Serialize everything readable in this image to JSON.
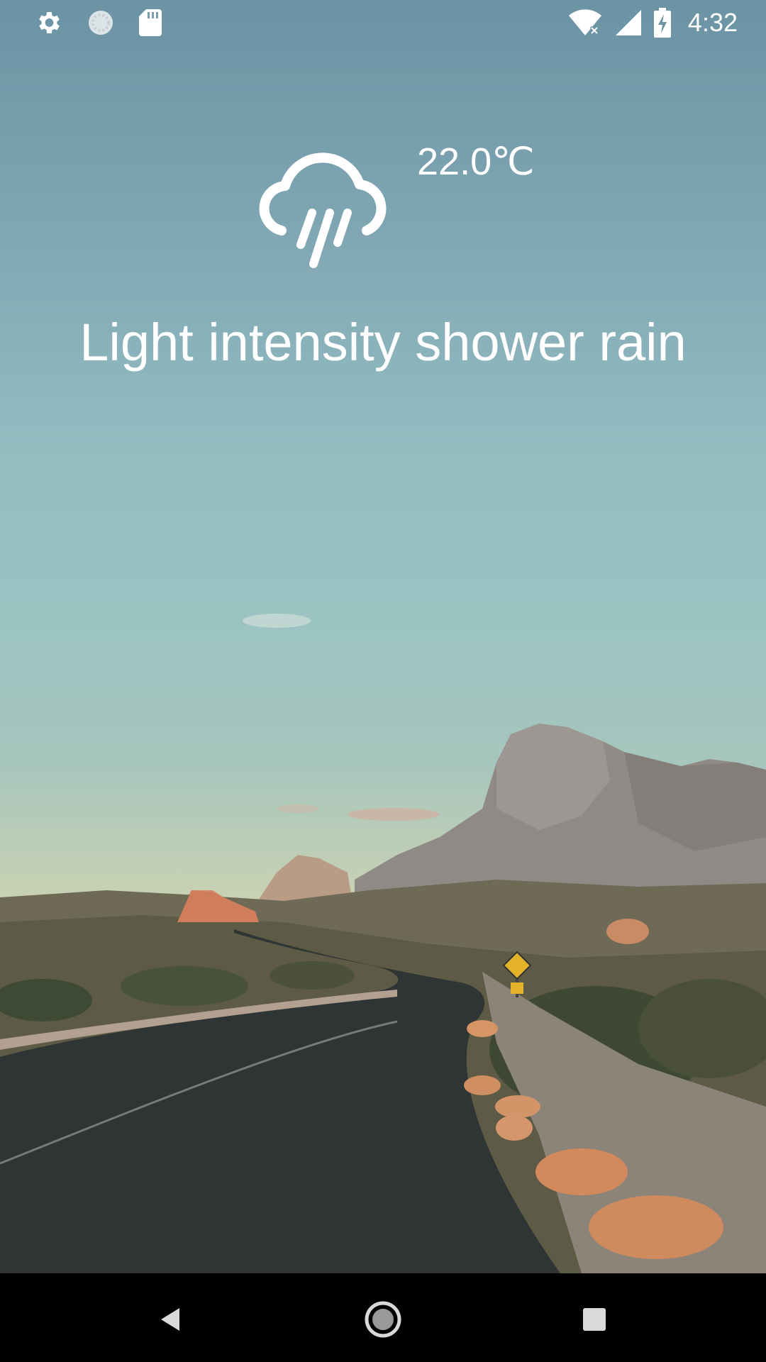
{
  "status_bar": {
    "left_icons": [
      "gear-icon",
      "sync-icon",
      "sd-card-icon"
    ],
    "right_icons": [
      "wifi-no-internet-icon",
      "cellular-signal-icon",
      "battery-charging-icon"
    ],
    "time": "4:32"
  },
  "weather": {
    "icon": "rain-cloud-icon",
    "temperature": "22.0℃",
    "description": "Light intensity shower rain"
  },
  "nav_bar": {
    "buttons": [
      "back-icon",
      "home-icon",
      "recents-icon"
    ]
  },
  "colors": {
    "sky_top": "#6b93a4",
    "sky_mid": "#9ac3c2",
    "horizon": "#e3d9b0",
    "text": "#ffffff",
    "nav_background": "#000000"
  }
}
